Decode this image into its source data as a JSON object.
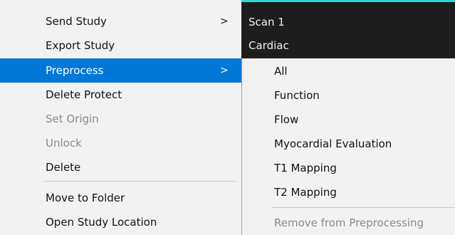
{
  "background_window": {
    "items": [
      "Scan 1",
      "Cardiac"
    ],
    "accent_color": "#2fd6d0"
  },
  "context_menu": {
    "items": [
      {
        "label": "Send Study",
        "has_submenu": true,
        "submenu_glyph": ">",
        "enabled": true
      },
      {
        "label": "Export Study",
        "enabled": true
      },
      {
        "label": "Preprocess",
        "has_submenu": true,
        "submenu_glyph": ">",
        "enabled": true,
        "highlighted": true
      },
      {
        "label": "Delete Protect",
        "enabled": true
      },
      {
        "label": "Set Origin",
        "enabled": false
      },
      {
        "label": "Unlock",
        "enabled": false
      },
      {
        "label": "Delete",
        "enabled": true
      },
      {
        "label": "Move to Folder",
        "enabled": true
      },
      {
        "label": "Open Study Location",
        "enabled": true
      }
    ],
    "highlight_color": "#0078d7"
  },
  "preprocess_submenu": {
    "items": [
      {
        "label": "All",
        "enabled": true
      },
      {
        "label": "Function",
        "enabled": true
      },
      {
        "label": "Flow",
        "enabled": true
      },
      {
        "label": "Myocardial Evaluation",
        "enabled": true
      },
      {
        "label": "T1 Mapping",
        "enabled": true
      },
      {
        "label": "T2 Mapping",
        "enabled": true
      },
      {
        "label": "Remove from Preprocessing",
        "enabled": false
      }
    ]
  }
}
